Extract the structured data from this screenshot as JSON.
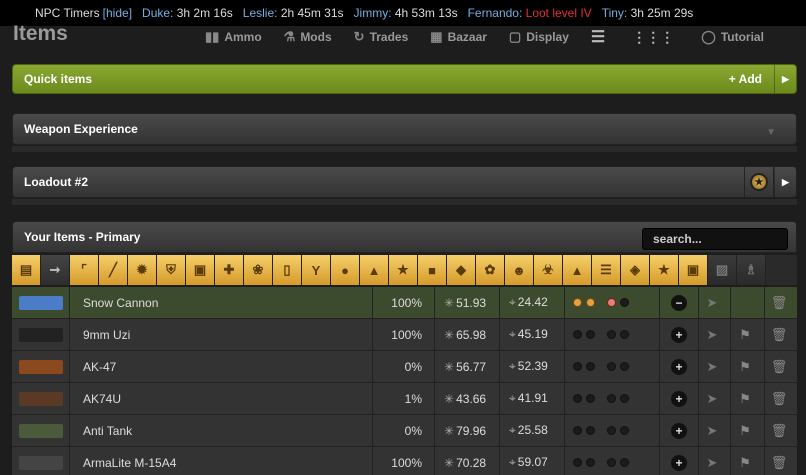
{
  "npc_bar": {
    "title": "NPC Timers",
    "hide_label": "[hide]",
    "npcs": [
      {
        "name": "Duke:",
        "time": "3h 2m 16s",
        "loot": false
      },
      {
        "name": "Leslie:",
        "time": "2h 45m 31s",
        "loot": false
      },
      {
        "name": "Jimmy:",
        "time": "4h 53m 13s",
        "loot": false
      },
      {
        "name": "Fernando:",
        "time": "Loot level IV",
        "loot": true
      },
      {
        "name": "Tiny:",
        "time": "3h 25m 29s",
        "loot": false
      }
    ]
  },
  "header": {
    "title": "Items",
    "links": [
      {
        "icon": "ammo-icon",
        "label": "Ammo"
      },
      {
        "icon": "mods-icon",
        "label": "Mods"
      },
      {
        "icon": "trades-icon",
        "label": "Trades"
      },
      {
        "icon": "bazaar-icon",
        "label": "Bazaar"
      },
      {
        "icon": "display-icon",
        "label": "Display"
      },
      {
        "icon": "list-view-icon",
        "label": ""
      },
      {
        "icon": "grid-view-icon",
        "label": ""
      },
      {
        "icon": "tutorial-icon",
        "label": "Tutorial"
      }
    ]
  },
  "quick_items": {
    "title": "Quick items",
    "add_label": "+ Add"
  },
  "weapon_experience": {
    "title": "Weapon Experience"
  },
  "loadout": {
    "title": "Loadout #2"
  },
  "your_items": {
    "title": "Your Items - Primary",
    "search_placeholder": "search..."
  },
  "categories": [
    "folder",
    "primary",
    "secondary",
    "melee",
    "temporary",
    "defensive",
    "clothing",
    "medical",
    "drug",
    "energy-drink",
    "alcohol",
    "candy",
    "booster",
    "special",
    "tool",
    "jewelry",
    "flower",
    "plushie",
    "hazard",
    "supply-pack",
    "collectible",
    "artifact",
    "star",
    "enhancer",
    "car",
    "trophy"
  ],
  "items": [
    {
      "name": "Snow Cannon",
      "quality": "100%",
      "damage": "51.93",
      "accuracy": "24.42",
      "equipped": true,
      "mods": [
        "on",
        "on",
        "on2",
        "off"
      ],
      "gun_color": "#4a7cc8"
    },
    {
      "name": "9mm Uzi",
      "quality": "100%",
      "damage": "65.98",
      "accuracy": "45.19",
      "equipped": false,
      "mods": [
        "off",
        "off",
        "off",
        "off"
      ],
      "gun_color": "#222"
    },
    {
      "name": "AK-47",
      "quality": "0%",
      "damage": "56.77",
      "accuracy": "52.39",
      "equipped": false,
      "mods": [
        "off",
        "off",
        "off",
        "off"
      ],
      "gun_color": "#8a4a1e"
    },
    {
      "name": "AK74U",
      "quality": "1%",
      "damage": "43.66",
      "accuracy": "41.91",
      "equipped": false,
      "mods": [
        "off",
        "off",
        "off",
        "off"
      ],
      "gun_color": "#5a3a24"
    },
    {
      "name": "Anti Tank",
      "quality": "0%",
      "damage": "79.96",
      "accuracy": "25.58",
      "equipped": false,
      "mods": [
        "off",
        "off",
        "off",
        "off"
      ],
      "gun_color": "#4a5a3a"
    },
    {
      "name": "ArmaLite M-15A4",
      "quality": "100%",
      "damage": "70.28",
      "accuracy": "59.07",
      "equipped": false,
      "mods": [
        "off",
        "off",
        "off",
        "off"
      ],
      "gun_color": "#444"
    }
  ]
}
